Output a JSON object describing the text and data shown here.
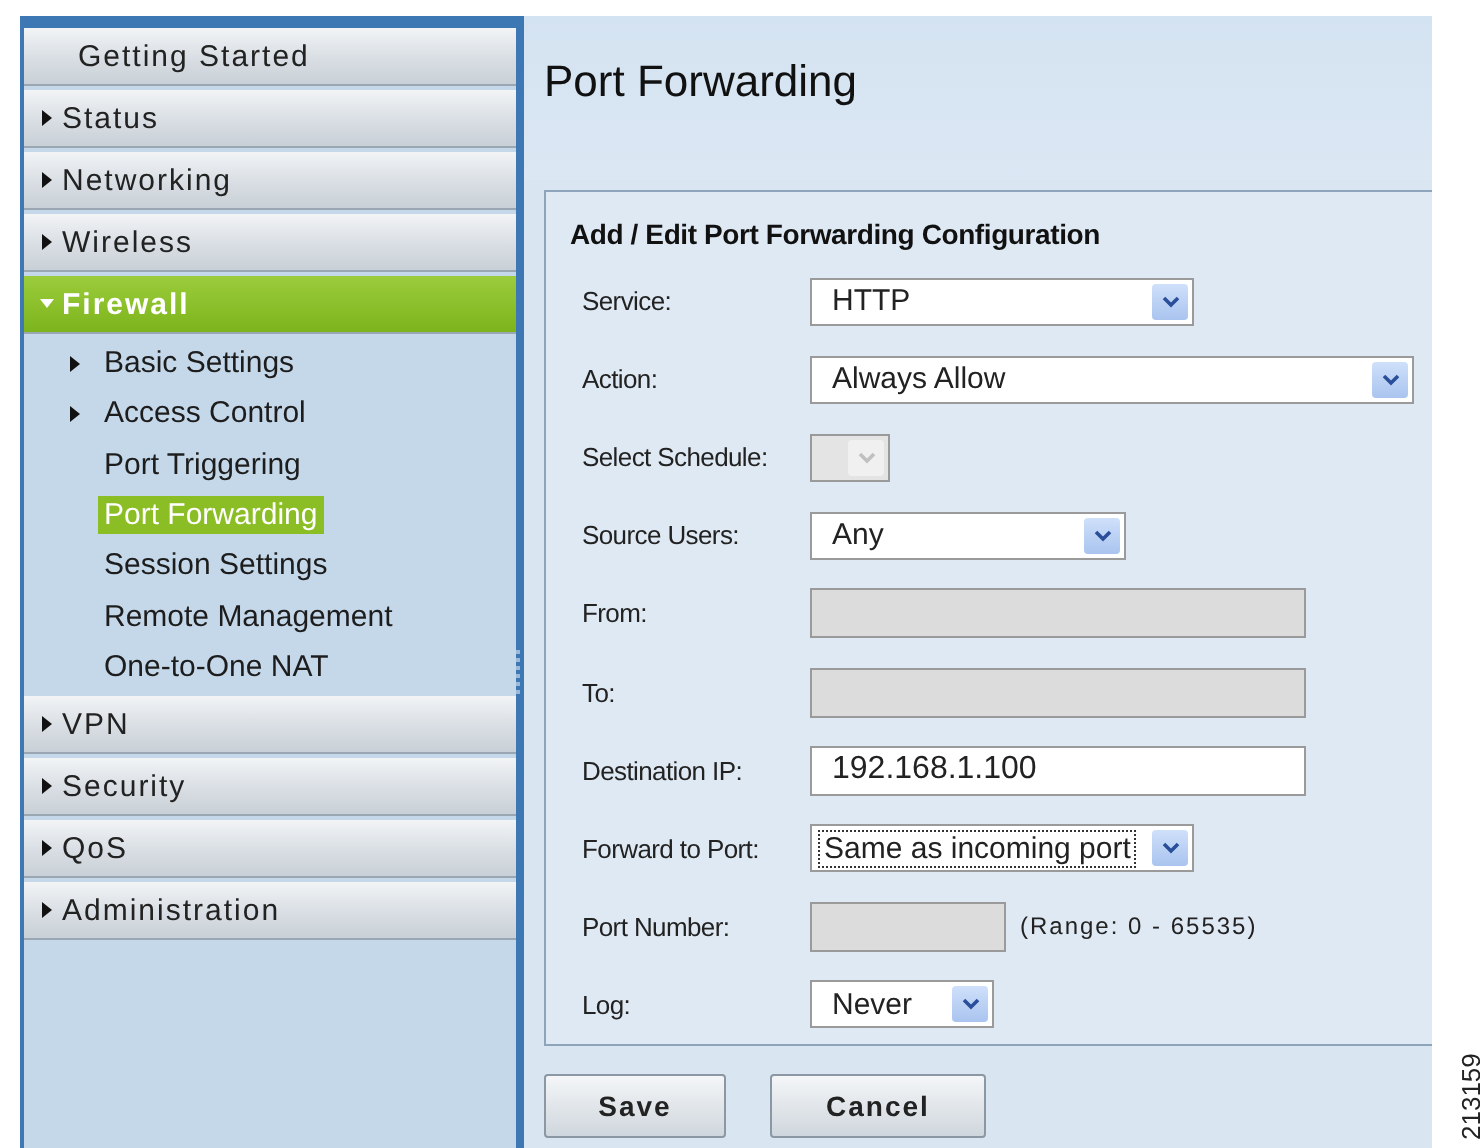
{
  "sidebar": {
    "items": [
      {
        "label": "Getting Started",
        "kind": "link",
        "selected": false
      },
      {
        "label": "Status",
        "kind": "group",
        "expanded": false,
        "selected": false
      },
      {
        "label": "Networking",
        "kind": "group",
        "expanded": false,
        "selected": false
      },
      {
        "label": "Wireless",
        "kind": "group",
        "expanded": false,
        "selected": false
      },
      {
        "label": "Firewall",
        "kind": "group",
        "expanded": true,
        "selected": true,
        "children": [
          {
            "label": "Basic Settings",
            "kind": "group",
            "selected": false
          },
          {
            "label": "Access Control",
            "kind": "group",
            "selected": false
          },
          {
            "label": "Port Triggering",
            "kind": "link",
            "selected": false
          },
          {
            "label": "Port Forwarding",
            "kind": "link",
            "selected": true
          },
          {
            "label": "Session Settings",
            "kind": "link",
            "selected": false
          },
          {
            "label": "Remote Management",
            "kind": "link",
            "selected": false
          },
          {
            "label": "One-to-One NAT",
            "kind": "link",
            "selected": false
          }
        ]
      },
      {
        "label": "VPN",
        "kind": "group",
        "expanded": false,
        "selected": false
      },
      {
        "label": "Security",
        "kind": "group",
        "expanded": false,
        "selected": false
      },
      {
        "label": "QoS",
        "kind": "group",
        "expanded": false,
        "selected": false
      },
      {
        "label": "Administration",
        "kind": "group",
        "expanded": false,
        "selected": false
      }
    ]
  },
  "page": {
    "title": "Port Forwarding"
  },
  "form": {
    "heading": "Add / Edit Port Forwarding Configuration",
    "fields": [
      {
        "label": "Service:",
        "kind": "select",
        "value": "HTTP",
        "disabled": false,
        "focused": false
      },
      {
        "label": "Action:",
        "kind": "select",
        "value": "Always Allow",
        "disabled": false,
        "focused": false
      },
      {
        "label": "Select Schedule:",
        "kind": "select",
        "disabled": true,
        "focused": false
      },
      {
        "label": "Source Users:",
        "kind": "select",
        "value": "Any",
        "disabled": false,
        "focused": false
      },
      {
        "label": "From:",
        "kind": "input",
        "disabled": true
      },
      {
        "label": "To:",
        "kind": "input",
        "disabled": true
      },
      {
        "label": "Destination IP:",
        "kind": "input",
        "value": "192.168.1.100",
        "disabled": false
      },
      {
        "label": "Forward to Port:",
        "kind": "select",
        "value": "Same as incoming port",
        "disabled": false,
        "focused": true
      },
      {
        "label": "Port Number:",
        "kind": "input",
        "disabled": true,
        "hint": "(Range: 0 - 65535)"
      },
      {
        "label": "Log:",
        "kind": "select",
        "value": "Never",
        "disabled": false,
        "focused": false
      }
    ]
  },
  "buttons": [
    "Save",
    "Cancel"
  ],
  "figure_id": "213159"
}
